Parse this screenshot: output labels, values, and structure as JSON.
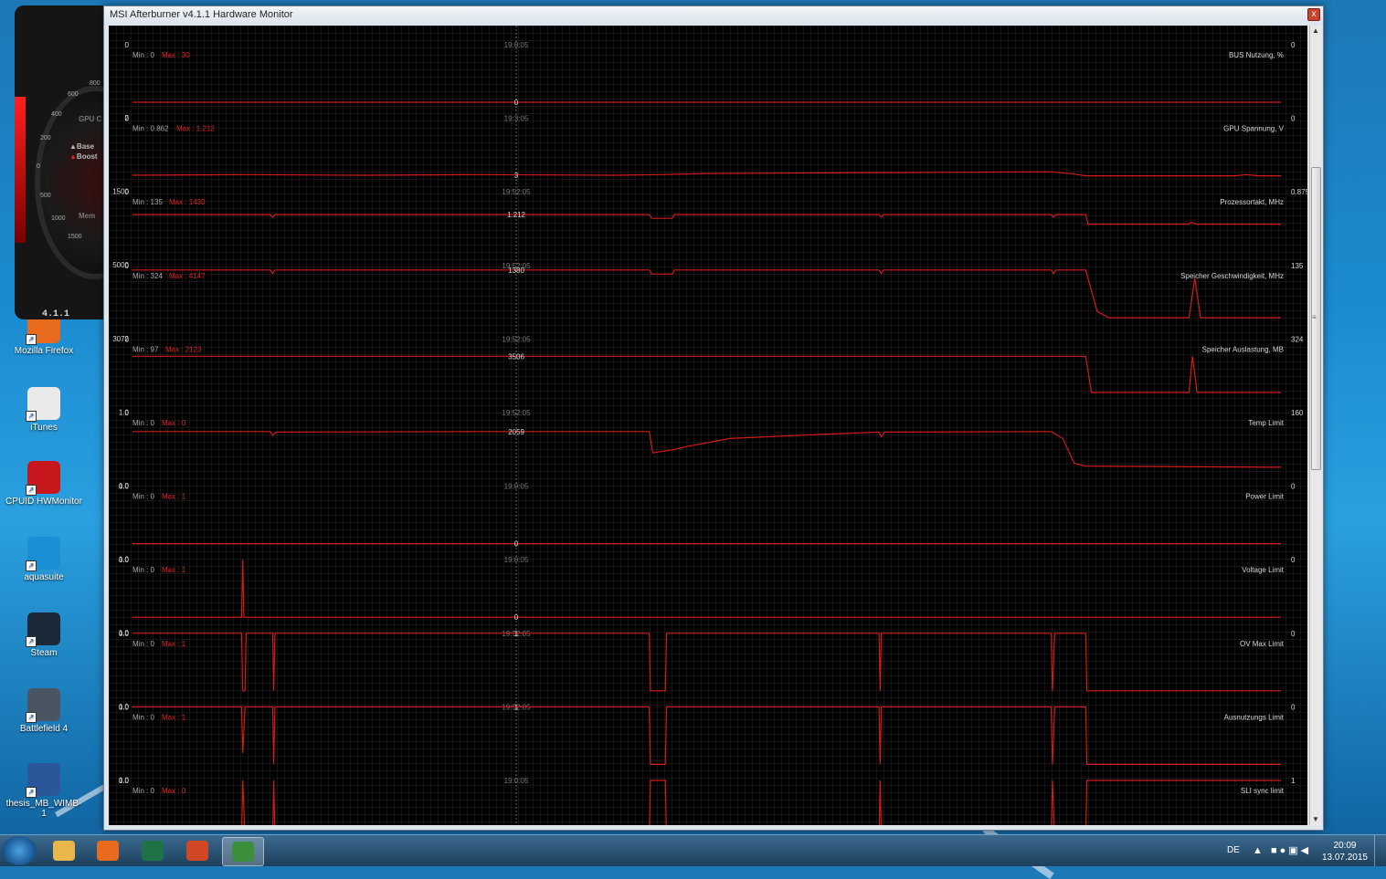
{
  "desktop": {
    "icons": [
      {
        "label": "Mozilla Firefox",
        "color": "#e86a1c"
      },
      {
        "label": "iTunes",
        "color": "#eaeaea"
      },
      {
        "label": "CPUID HWMonitor",
        "color": "#c8161d"
      },
      {
        "label": "aquasuite",
        "color": "#1a8fd6"
      },
      {
        "label": "Steam",
        "color": "#1b2838"
      },
      {
        "label": "Battlefield 4",
        "color": "#4a5563"
      },
      {
        "label": "thesis_MB_WIMB-1",
        "color": "#2b579a"
      }
    ]
  },
  "afterburner_skin": {
    "version": "4.1.1",
    "base_label": "Base",
    "boost_label": "Boost",
    "gpu_label": "GPU C",
    "mem_label": "Mem",
    "ticks": [
      "200",
      "400",
      "600",
      "800",
      "0",
      "500",
      "1000",
      "1500"
    ]
  },
  "window": {
    "title": "MSI Afterburner v4.1.1 Hardware Monitor",
    "close_label": "x"
  },
  "monitor": {
    "time_label": "19:52:05",
    "colors": {
      "line": "#d11a1a",
      "text": "#d6d6d6",
      "min_text": "#a8a8a8",
      "max_text": "#e02020"
    },
    "graphs": [
      {
        "name": "BUS Nutzung, %",
        "top": "0",
        "bottom": "100",
        "min": "Min : 0",
        "max": "Max : 30",
        "current": "0",
        "time_label": "19:0:05",
        "mid_value": "0",
        "points": [
          [
            0,
            0
          ],
          [
            1,
            0
          ]
        ]
      },
      {
        "name": "GPU Spannung, V",
        "top": "0",
        "bottom": "2",
        "min": "Min : 0.862",
        "max": "Max : 1.212",
        "current": "0",
        "time_label": "19:3:05",
        "mid_value": "3",
        "points": [
          [
            0,
            0.01
          ],
          [
            0.1,
            0.02
          ],
          [
            0.2,
            0.01
          ],
          [
            0.3,
            0.02
          ],
          [
            0.42,
            0.01
          ],
          [
            0.46,
            0.02
          ],
          [
            0.5,
            0.04
          ],
          [
            0.6,
            0.05
          ],
          [
            0.7,
            0.06
          ],
          [
            0.8,
            0.07
          ],
          [
            0.82,
            0.03
          ],
          [
            0.83,
            0.0
          ],
          [
            0.96,
            0.0
          ],
          [
            0.97,
            0.02
          ],
          [
            0.98,
            0.0
          ],
          [
            1,
            0
          ]
        ]
      },
      {
        "name": "Prozessortakt, MHz",
        "top": "0",
        "bottom": "1500",
        "min": "Min : 135",
        "max": "Max : 1430",
        "current": "0.875",
        "time_label": "19:52:05",
        "mid_value": "1.212",
        "points": [
          [
            0,
            0.606
          ],
          [
            0.12,
            0.606
          ],
          [
            0.122,
            0.56
          ],
          [
            0.124,
            0.606
          ],
          [
            0.45,
            0.606
          ],
          [
            0.452,
            0.54
          ],
          [
            0.47,
            0.54
          ],
          [
            0.472,
            0.606
          ],
          [
            0.65,
            0.606
          ],
          [
            0.652,
            0.56
          ],
          [
            0.654,
            0.606
          ],
          [
            0.8,
            0.606
          ],
          [
            0.802,
            0.56
          ],
          [
            0.804,
            0.606
          ],
          [
            0.83,
            0.606
          ],
          [
            0.832,
            0.4375
          ],
          [
            0.92,
            0.4375
          ],
          [
            0.922,
            0.47
          ],
          [
            0.926,
            0.4375
          ],
          [
            1,
            0.4375
          ]
        ]
      },
      {
        "name": "Speicher Geschwindigkeit, MHz",
        "top": "0",
        "bottom": "5000",
        "min": "Min : 324",
        "max": "Max : 4147",
        "current": "135",
        "time_label": "19:52:05",
        "mid_value": "1380",
        "points": [
          [
            0,
            0.92
          ],
          [
            0.12,
            0.92
          ],
          [
            0.122,
            0.86
          ],
          [
            0.124,
            0.92
          ],
          [
            0.45,
            0.92
          ],
          [
            0.452,
            0.85
          ],
          [
            0.47,
            0.85
          ],
          [
            0.472,
            0.92
          ],
          [
            0.65,
            0.92
          ],
          [
            0.652,
            0.86
          ],
          [
            0.654,
            0.92
          ],
          [
            0.8,
            0.92
          ],
          [
            0.802,
            0.86
          ],
          [
            0.804,
            0.92
          ],
          [
            0.83,
            0.92
          ],
          [
            0.84,
            0.2
          ],
          [
            0.85,
            0.09
          ],
          [
            0.92,
            0.09
          ],
          [
            0.925,
            0.78
          ],
          [
            0.93,
            0.09
          ],
          [
            1,
            0.09
          ]
        ]
      },
      {
        "name": "Speicher Auslastung, MB",
        "top": "0",
        "bottom": "3072",
        "min": "Min : 97",
        "max": "Max : 2123",
        "current": "324",
        "time_label": "19:52:05",
        "mid_value": "3506",
        "points": [
          [
            0,
            0.7
          ],
          [
            0.83,
            0.7
          ],
          [
            0.835,
            0.07
          ],
          [
            0.92,
            0.07
          ],
          [
            0.923,
            0.7
          ],
          [
            0.927,
            0.07
          ],
          [
            1,
            0.07
          ]
        ]
      },
      {
        "name": "Temp Limit",
        "top": "0",
        "bottom": "1.0",
        "min": "Min : 0",
        "max": "Max : 0",
        "current": "160",
        "time_label": "19:52:05",
        "mid_value": "2059",
        "points": [
          [
            0,
            0.67
          ],
          [
            0.12,
            0.67
          ],
          [
            0.122,
            0.6
          ],
          [
            0.125,
            0.66
          ],
          [
            0.3,
            0.67
          ],
          [
            0.45,
            0.67
          ],
          [
            0.453,
            0.3
          ],
          [
            0.47,
            0.35
          ],
          [
            0.48,
            0.4
          ],
          [
            0.52,
            0.55
          ],
          [
            0.6,
            0.62
          ],
          [
            0.65,
            0.66
          ],
          [
            0.652,
            0.58
          ],
          [
            0.655,
            0.66
          ],
          [
            0.8,
            0.67
          ],
          [
            0.81,
            0.55
          ],
          [
            0.82,
            0.12
          ],
          [
            0.83,
            0.07
          ],
          [
            1,
            0.05
          ]
        ]
      },
      {
        "name": "Power Limit",
        "top": "0.0",
        "bottom": "1.0",
        "min": "Min : 0",
        "max": "Max : 1",
        "current": "0",
        "time_label": "19:0:05",
        "mid_value": "0",
        "points": [
          [
            0,
            0
          ],
          [
            1,
            0
          ]
        ]
      },
      {
        "name": "Voltage Limit",
        "top": "0.0",
        "bottom": "1.0",
        "min": "Min : 0",
        "max": "Max : 1",
        "current": "0",
        "time_label": "19:0:05",
        "mid_value": "0",
        "points": [
          [
            0,
            0
          ],
          [
            0.095,
            0
          ],
          [
            0.096,
            1
          ],
          [
            0.097,
            0
          ],
          [
            1,
            0
          ]
        ]
      },
      {
        "name": "OV Max Limit",
        "top": "0.0",
        "bottom": "1.0",
        "min": "Min : 0",
        "max": "Max : 1",
        "current": "0",
        "time_label": "19:52:05",
        "mid_value": "1",
        "points": [
          [
            0,
            1
          ],
          [
            0.095,
            1
          ],
          [
            0.096,
            0
          ],
          [
            0.098,
            0
          ],
          [
            0.099,
            1
          ],
          [
            0.122,
            1
          ],
          [
            0.123,
            0
          ],
          [
            0.124,
            1
          ],
          [
            0.45,
            1
          ],
          [
            0.451,
            0
          ],
          [
            0.464,
            0
          ],
          [
            0.465,
            1
          ],
          [
            0.65,
            1
          ],
          [
            0.651,
            0
          ],
          [
            0.652,
            1
          ],
          [
            0.8,
            1
          ],
          [
            0.801,
            0
          ],
          [
            0.803,
            1
          ],
          [
            0.83,
            1
          ],
          [
            0.831,
            0
          ],
          [
            1,
            0
          ]
        ]
      },
      {
        "name": "Ausnutzungs Limit",
        "top": "0.0",
        "bottom": "1.0",
        "min": "Min : 0",
        "max": "Max : 1",
        "current": "0",
        "time_label": "19:52:05",
        "mid_value": "1",
        "points": [
          [
            0,
            1
          ],
          [
            0.095,
            1
          ],
          [
            0.096,
            0.2
          ],
          [
            0.098,
            1
          ],
          [
            0.122,
            1
          ],
          [
            0.123,
            0
          ],
          [
            0.124,
            1
          ],
          [
            0.45,
            1
          ],
          [
            0.451,
            0
          ],
          [
            0.464,
            0
          ],
          [
            0.465,
            1
          ],
          [
            0.65,
            1
          ],
          [
            0.651,
            0
          ],
          [
            0.652,
            1
          ],
          [
            0.8,
            1
          ],
          [
            0.801,
            0
          ],
          [
            0.803,
            1
          ],
          [
            0.83,
            1
          ],
          [
            0.831,
            0
          ],
          [
            1,
            0
          ]
        ]
      },
      {
        "name": "SLI sync limit",
        "top": "0.0",
        "bottom": "1.0",
        "min": "Min : 0",
        "max": "Max : 0",
        "current": "1",
        "time_label": "19:0:05",
        "mid_value": "",
        "points": [
          [
            0,
            0
          ],
          [
            0.095,
            0
          ],
          [
            0.096,
            1
          ],
          [
            0.098,
            0
          ],
          [
            0.122,
            0
          ],
          [
            0.123,
            1
          ],
          [
            0.124,
            0
          ],
          [
            0.45,
            0
          ],
          [
            0.451,
            1
          ],
          [
            0.464,
            1
          ],
          [
            0.465,
            0
          ],
          [
            0.65,
            0
          ],
          [
            0.651,
            1
          ],
          [
            0.652,
            0
          ],
          [
            0.8,
            0
          ],
          [
            0.801,
            1
          ],
          [
            0.803,
            0
          ],
          [
            0.83,
            0
          ],
          [
            0.831,
            1
          ],
          [
            1,
            1
          ]
        ]
      }
    ]
  },
  "taskbar": {
    "apps": [
      {
        "name": "explorer",
        "color": "#e8b64a"
      },
      {
        "name": "firefox",
        "color": "#e86a1c"
      },
      {
        "name": "excel",
        "color": "#1f7246"
      },
      {
        "name": "powerpoint",
        "color": "#d24726"
      },
      {
        "name": "afterburner",
        "color": "#3c8f3c"
      }
    ],
    "lang": "DE",
    "time": "20:09",
    "date": "13.07.2015"
  }
}
